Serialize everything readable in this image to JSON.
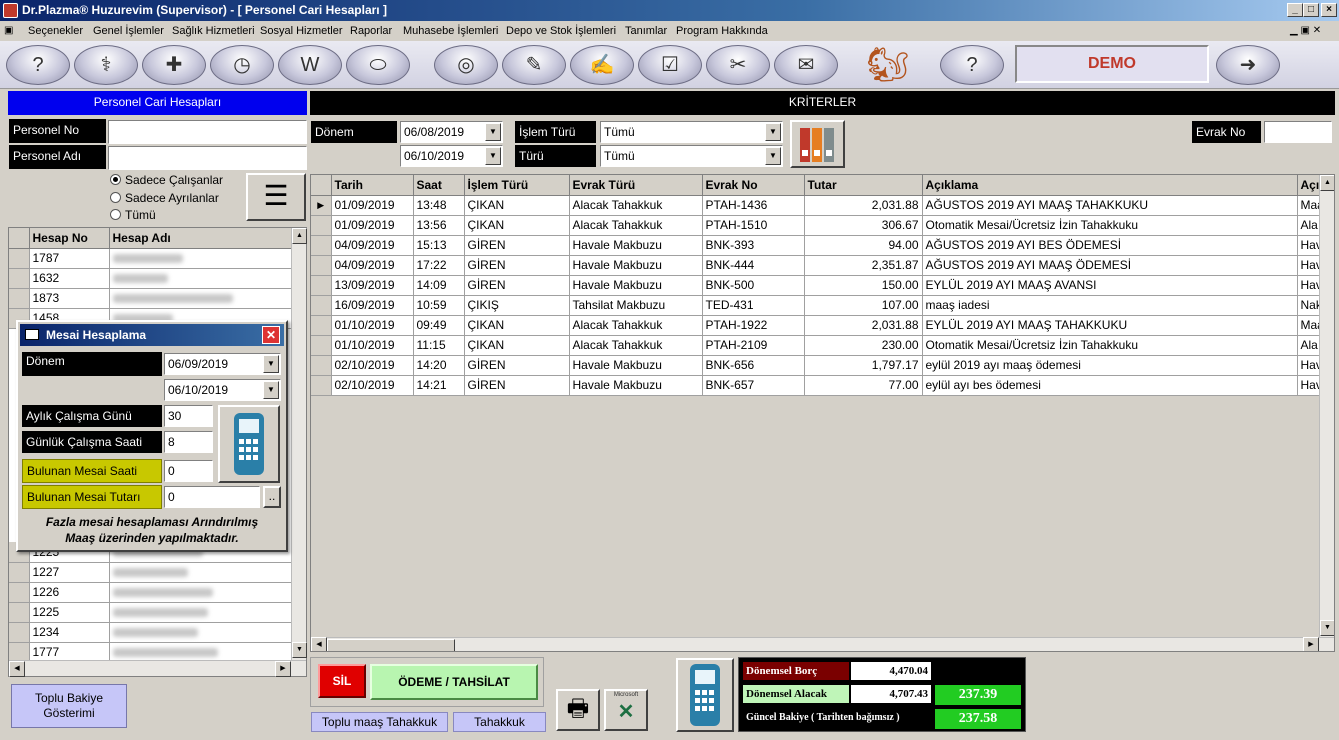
{
  "window": {
    "title": "Dr.Plazma® Huzurevim (Supervisor) - [ Personel Cari Hesapları ]"
  },
  "menu": [
    "Seçenekler",
    "Genel İşlemler",
    "Sağlık Hizmetleri",
    "Sosyal Hizmetler",
    "Raporlar",
    "Muhasebe İşlemleri",
    "Depo ve Stok İşlemleri",
    "Tanımlar",
    "Program Hakkında"
  ],
  "toolbar": {
    "demo_label": "DEMO"
  },
  "left": {
    "header": "Personel Cari Hesapları",
    "personel_no_label": "Personel No",
    "personel_no_value": "",
    "personel_adi_label": "Personel Adı",
    "personel_adi_value": "",
    "radio": {
      "opt1": "Sadece Çalışanlar",
      "opt2": "Sadece Ayrılanlar",
      "opt3": "Tümü",
      "selected": "Sadece Çalışanlar"
    },
    "grid": {
      "columns": {
        "no": "Hesap No",
        "name": "Hesap Adı"
      },
      "top_rows": [
        "1787",
        "1632",
        "1873",
        "1458"
      ],
      "bottom_rows": [
        "1225",
        "1227",
        "1226",
        "1225",
        "1234",
        "1777"
      ]
    },
    "toplu_bakiye": "Toplu Bakiye Gösterimi"
  },
  "criteria": {
    "header": "KRİTERLER",
    "donem_label": "Dönem",
    "date_from": "06/08/2019",
    "date_to": "06/10/2019",
    "islem_turu_label": "İşlem Türü",
    "islem_turu_value": "Tümü",
    "turu_label": "Türü",
    "turu_value": "Tümü",
    "evrak_no_label": "Evrak No",
    "evrak_no_value": ""
  },
  "grid": {
    "columns": {
      "tarih": "Tarih",
      "saat": "Saat",
      "islem": "İşlem Türü",
      "evrak_turu": "Evrak Türü",
      "evrak_no": "Evrak No",
      "tutar": "Tutar",
      "aciklama": "Açıklama",
      "extra": "Açı"
    },
    "rows": [
      {
        "tarih": "01/09/2019",
        "saat": "13:48",
        "islem": "ÇIKAN",
        "evrak_turu": "Alacak Tahakkuk",
        "evrak_no": "PTAH-1436",
        "tutar": "2,031.88",
        "aciklama": "AĞUSTOS 2019 AYI MAAŞ TAHAKKUKU",
        "extra": "Maa"
      },
      {
        "tarih": "01/09/2019",
        "saat": "13:56",
        "islem": "ÇIKAN",
        "evrak_turu": "Alacak Tahakkuk",
        "evrak_no": "PTAH-1510",
        "tutar": "306.67",
        "aciklama": "Otomatik Mesai/Ücretsiz İzin Tahakkuku",
        "extra": "Ala"
      },
      {
        "tarih": "04/09/2019",
        "saat": "15:13",
        "islem": "GİREN",
        "evrak_turu": "Havale Makbuzu",
        "evrak_no": "BNK-393",
        "tutar": "94.00",
        "aciklama": "AĞUSTOS 2019 AYI BES ÖDEMESİ",
        "extra": "Hav"
      },
      {
        "tarih": "04/09/2019",
        "saat": "17:22",
        "islem": "GİREN",
        "evrak_turu": "Havale Makbuzu",
        "evrak_no": "BNK-444",
        "tutar": "2,351.87",
        "aciklama": "AĞUSTOS 2019 AYI MAAŞ ÖDEMESİ",
        "extra": "Hav"
      },
      {
        "tarih": "13/09/2019",
        "saat": "14:09",
        "islem": "GİREN",
        "evrak_turu": "Havale Makbuzu",
        "evrak_no": "BNK-500",
        "tutar": "150.00",
        "aciklama": "EYLÜL 2019 AYI MAAŞ AVANSI",
        "extra": "Hav"
      },
      {
        "tarih": "16/09/2019",
        "saat": "10:59",
        "islem": "ÇIKIŞ",
        "evrak_turu": "Tahsilat Makbuzu",
        "evrak_no": "TED-431",
        "tutar": "107.00",
        "aciklama": "maaş iadesi",
        "extra": "Nak"
      },
      {
        "tarih": "01/10/2019",
        "saat": "09:49",
        "islem": "ÇIKAN",
        "evrak_turu": "Alacak Tahakkuk",
        "evrak_no": "PTAH-1922",
        "tutar": "2,031.88",
        "aciklama": "EYLÜL 2019 AYI MAAŞ TAHAKKUKU",
        "extra": "Maa"
      },
      {
        "tarih": "01/10/2019",
        "saat": "11:15",
        "islem": "ÇIKAN",
        "evrak_turu": "Alacak Tahakkuk",
        "evrak_no": "PTAH-2109",
        "tutar": "230.00",
        "aciklama": "Otomatik Mesai/Ücretsiz İzin Tahakkuku",
        "extra": "Ala"
      },
      {
        "tarih": "02/10/2019",
        "saat": "14:20",
        "islem": "GİREN",
        "evrak_turu": "Havale Makbuzu",
        "evrak_no": "BNK-656",
        "tutar": "1,797.17",
        "aciklama": "eylül 2019 ayı maaş ödemesi",
        "extra": "Hav"
      },
      {
        "tarih": "02/10/2019",
        "saat": "14:21",
        "islem": "GİREN",
        "evrak_turu": "Havale Makbuzu",
        "evrak_no": "BNK-657",
        "tutar": "77.00",
        "aciklama": "eylül ayı bes ödemesi",
        "extra": "Hav"
      }
    ]
  },
  "mesai": {
    "title": "Mesai Hesaplama",
    "donem_label": "Dönem",
    "date_from": "06/09/2019",
    "date_to": "06/10/2019",
    "aylik_label": "Aylık Çalışma Günü",
    "aylik_value": "30",
    "gunluk_label": "Günlük Çalışma Saati",
    "gunluk_value": "8",
    "bulunan_saat_label": "Bulunan Mesai Saati",
    "bulunan_saat_value": "0",
    "bulunan_tutar_label": "Bulunan Mesai Tutarı",
    "bulunan_tutar_value": "0",
    "ellipsis": "..",
    "note_line1": "Fazla mesai hesaplaması Arındırılmış",
    "note_line2": "Maaş üzerinden yapılmaktadır."
  },
  "bottom": {
    "sil": "SİL",
    "odeme": "ÖDEME / TAHSİLAT",
    "toplu_maas": "Toplu maaş Tahakkuk",
    "tahakkuk": "Tahakkuk",
    "excel_label": "Microsoft"
  },
  "summary": {
    "borc_label": "Dönemsel Borç",
    "borc_value": "4,470.04",
    "alacak_label": "Dönemsel Alacak",
    "alacak_value": "4,707.43",
    "diff_value": "237.39",
    "guncel_label": "Güncel Bakiye ( Tarihten bağımsız )",
    "guncel_value": "237.58"
  },
  "colors": {
    "title_bar": "#0a246a",
    "left_header": "#0000ee",
    "criteria_header": "#000000",
    "green_value": "#22cc22",
    "demo_text": "#c0392b"
  }
}
